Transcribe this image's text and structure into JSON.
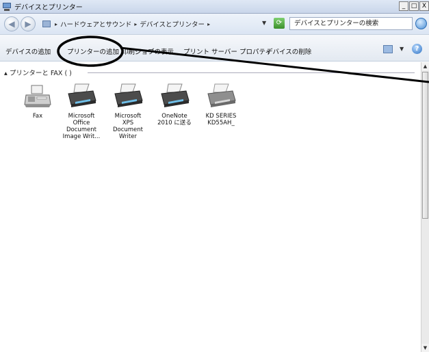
{
  "window": {
    "title": "デバイスとプリンター",
    "buttons": {
      "minimize": "_",
      "maximize": "□",
      "close": "X"
    }
  },
  "address": {
    "crumbs": [
      "ハードウェアとサウンド",
      "デバイスとプリンター"
    ],
    "search_placeholder": "デバイスとプリンターの検索"
  },
  "toolbar": {
    "add_device": "デバイスの追加",
    "add_printer": "プリンターの追加",
    "see_whats_printing": "印刷ジョブの表示",
    "print_server_properties": "プリント サーバー プロパティ",
    "remove_device": "デバイスの削除",
    "help": "?"
  },
  "group": {
    "header": "プリンターと FAX ( )"
  },
  "devices": [
    {
      "label": "Fax",
      "icon": "fax-icon"
    },
    {
      "label": "Microsoft\nOffice\nDocument\nImage Writ...",
      "icon": "printer-icon"
    },
    {
      "label": "Microsoft\nXPS\nDocument\nWriter",
      "icon": "printer-icon"
    },
    {
      "label": "OneNote\n2010 に送る",
      "icon": "printer-icon"
    },
    {
      "label": "KD SERIES\nKD55AH_",
      "icon": "printer-icon"
    }
  ],
  "colors": {
    "highlight_ellipse": "#000000",
    "titlebar": "#c9d6ea"
  }
}
